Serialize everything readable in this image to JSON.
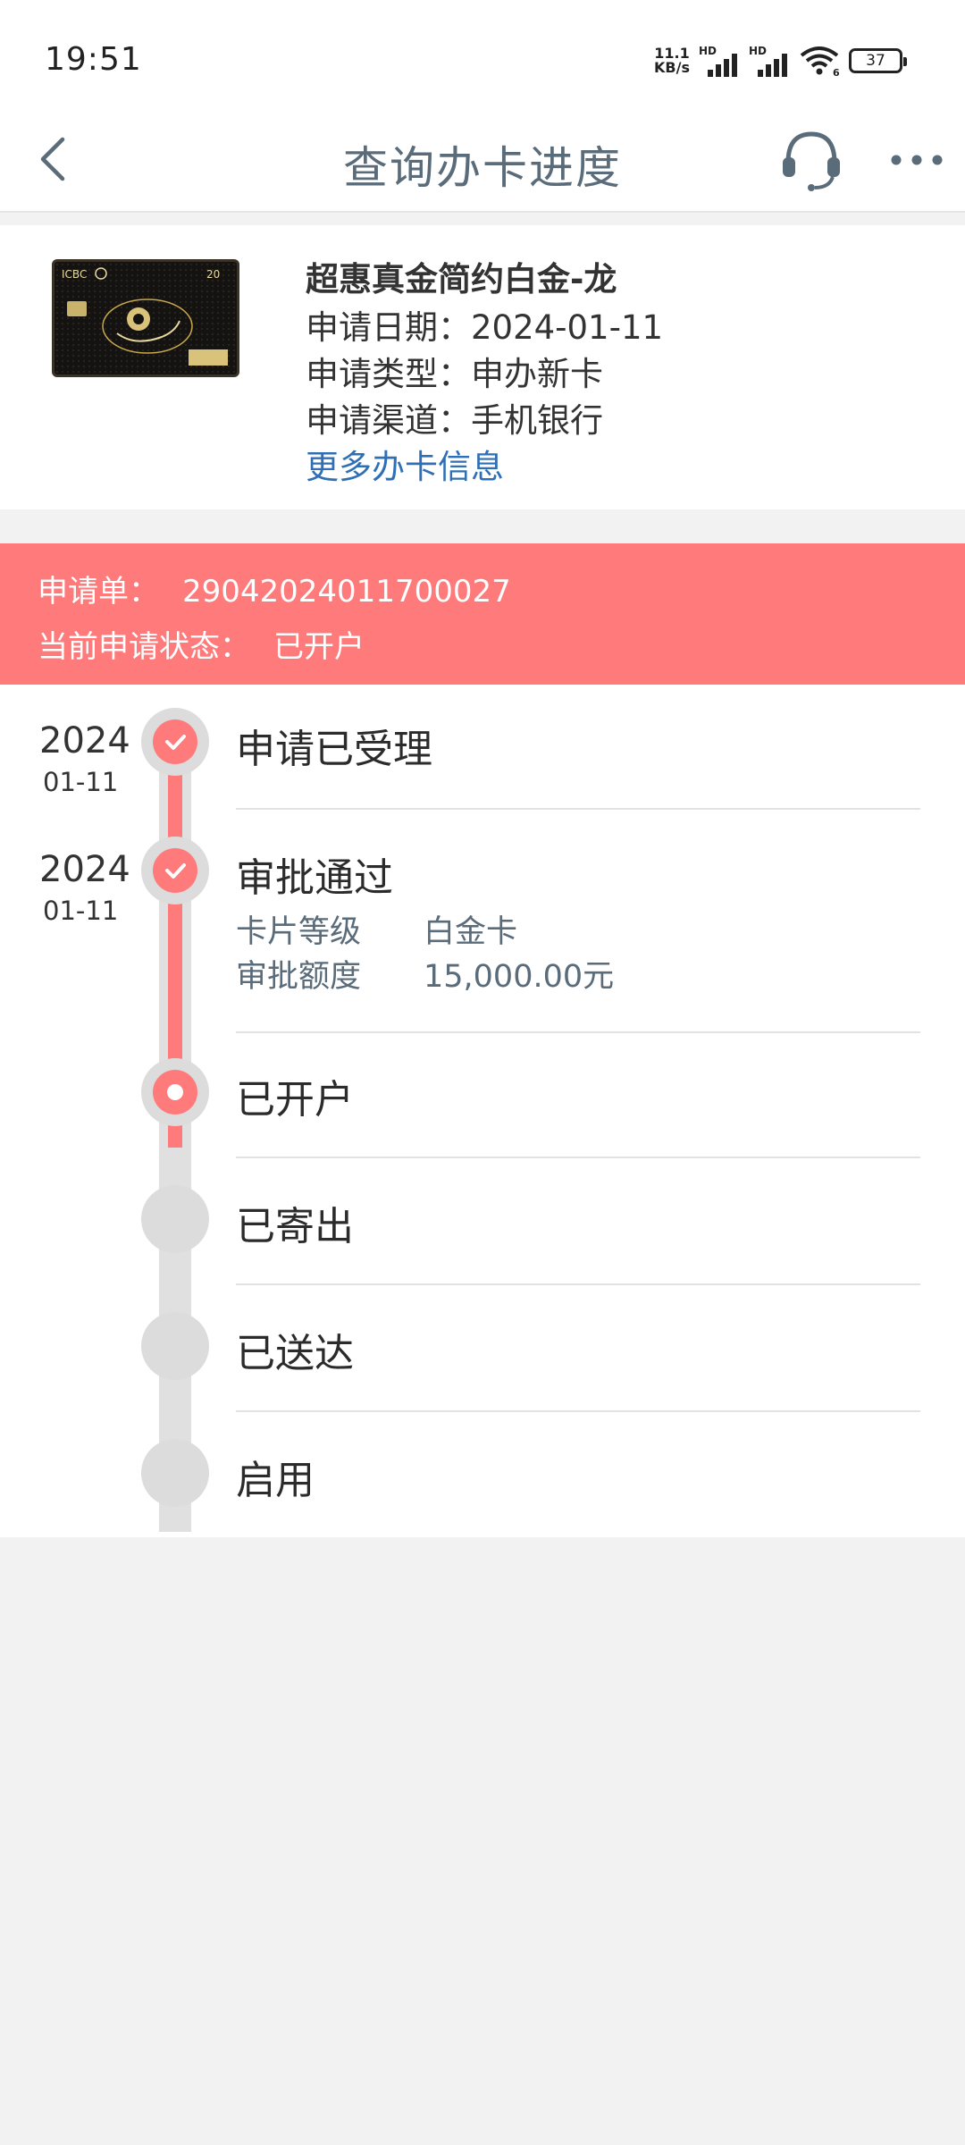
{
  "status_bar": {
    "time": "19:51",
    "net_speed_value": "11.1",
    "net_speed_unit": "KB/s",
    "hd_label": "HD",
    "wifi_badge": "6",
    "battery_level": "37"
  },
  "nav": {
    "title": "查询办卡进度",
    "icons": [
      "back-arrow-icon",
      "headset-icon",
      "more-icon"
    ]
  },
  "card": {
    "name": "超惠真金简约白金-龙",
    "date_line": "申请日期：2024-01-11",
    "type_line": "申请类型：申办新卡",
    "channel_line": "申请渠道：手机银行",
    "more_link": "更多办卡信息",
    "image_text": {
      "brand": "ICBC",
      "number": "20"
    }
  },
  "banner": {
    "order_label": "申请单：",
    "order_value": "29042024011700027",
    "status_label": "当前申请状态：",
    "status_value": "已开户"
  },
  "timeline": {
    "steps": [
      {
        "year": "2024",
        "date": "01-11",
        "title": "申请已受理",
        "state": "done"
      },
      {
        "year": "2024",
        "date": "01-11",
        "title": "审批通过",
        "state": "done",
        "details": [
          {
            "label": "卡片等级",
            "value": "白金卡"
          },
          {
            "label": "审批额度",
            "value": "15,000.00元"
          }
        ]
      },
      {
        "title": "已开户",
        "state": "current"
      },
      {
        "title": "已寄出",
        "state": "pending"
      },
      {
        "title": "已送达",
        "state": "pending"
      },
      {
        "title": "启用",
        "state": "pending"
      }
    ]
  },
  "colors": {
    "accent": "#ff7a7a",
    "link": "#2f6fb5",
    "title_gray": "#5a6b7a",
    "rail_gray": "#e0e0e0"
  }
}
